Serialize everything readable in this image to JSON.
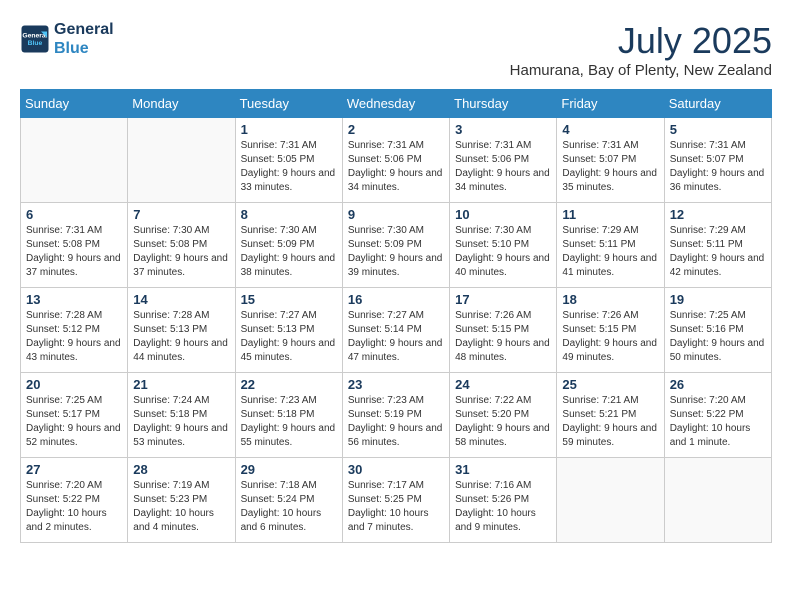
{
  "header": {
    "logo_line1": "General",
    "logo_line2": "Blue",
    "month_title": "July 2025",
    "subtitle": "Hamurana, Bay of Plenty, New Zealand"
  },
  "weekdays": [
    "Sunday",
    "Monday",
    "Tuesday",
    "Wednesday",
    "Thursday",
    "Friday",
    "Saturday"
  ],
  "weeks": [
    [
      {
        "day": "",
        "sunrise": "",
        "sunset": "",
        "daylight": ""
      },
      {
        "day": "",
        "sunrise": "",
        "sunset": "",
        "daylight": ""
      },
      {
        "day": "1",
        "sunrise": "Sunrise: 7:31 AM",
        "sunset": "Sunset: 5:05 PM",
        "daylight": "Daylight: 9 hours and 33 minutes."
      },
      {
        "day": "2",
        "sunrise": "Sunrise: 7:31 AM",
        "sunset": "Sunset: 5:06 PM",
        "daylight": "Daylight: 9 hours and 34 minutes."
      },
      {
        "day": "3",
        "sunrise": "Sunrise: 7:31 AM",
        "sunset": "Sunset: 5:06 PM",
        "daylight": "Daylight: 9 hours and 34 minutes."
      },
      {
        "day": "4",
        "sunrise": "Sunrise: 7:31 AM",
        "sunset": "Sunset: 5:07 PM",
        "daylight": "Daylight: 9 hours and 35 minutes."
      },
      {
        "day": "5",
        "sunrise": "Sunrise: 7:31 AM",
        "sunset": "Sunset: 5:07 PM",
        "daylight": "Daylight: 9 hours and 36 minutes."
      }
    ],
    [
      {
        "day": "6",
        "sunrise": "Sunrise: 7:31 AM",
        "sunset": "Sunset: 5:08 PM",
        "daylight": "Daylight: 9 hours and 37 minutes."
      },
      {
        "day": "7",
        "sunrise": "Sunrise: 7:30 AM",
        "sunset": "Sunset: 5:08 PM",
        "daylight": "Daylight: 9 hours and 37 minutes."
      },
      {
        "day": "8",
        "sunrise": "Sunrise: 7:30 AM",
        "sunset": "Sunset: 5:09 PM",
        "daylight": "Daylight: 9 hours and 38 minutes."
      },
      {
        "day": "9",
        "sunrise": "Sunrise: 7:30 AM",
        "sunset": "Sunset: 5:09 PM",
        "daylight": "Daylight: 9 hours and 39 minutes."
      },
      {
        "day": "10",
        "sunrise": "Sunrise: 7:30 AM",
        "sunset": "Sunset: 5:10 PM",
        "daylight": "Daylight: 9 hours and 40 minutes."
      },
      {
        "day": "11",
        "sunrise": "Sunrise: 7:29 AM",
        "sunset": "Sunset: 5:11 PM",
        "daylight": "Daylight: 9 hours and 41 minutes."
      },
      {
        "day": "12",
        "sunrise": "Sunrise: 7:29 AM",
        "sunset": "Sunset: 5:11 PM",
        "daylight": "Daylight: 9 hours and 42 minutes."
      }
    ],
    [
      {
        "day": "13",
        "sunrise": "Sunrise: 7:28 AM",
        "sunset": "Sunset: 5:12 PM",
        "daylight": "Daylight: 9 hours and 43 minutes."
      },
      {
        "day": "14",
        "sunrise": "Sunrise: 7:28 AM",
        "sunset": "Sunset: 5:13 PM",
        "daylight": "Daylight: 9 hours and 44 minutes."
      },
      {
        "day": "15",
        "sunrise": "Sunrise: 7:27 AM",
        "sunset": "Sunset: 5:13 PM",
        "daylight": "Daylight: 9 hours and 45 minutes."
      },
      {
        "day": "16",
        "sunrise": "Sunrise: 7:27 AM",
        "sunset": "Sunset: 5:14 PM",
        "daylight": "Daylight: 9 hours and 47 minutes."
      },
      {
        "day": "17",
        "sunrise": "Sunrise: 7:26 AM",
        "sunset": "Sunset: 5:15 PM",
        "daylight": "Daylight: 9 hours and 48 minutes."
      },
      {
        "day": "18",
        "sunrise": "Sunrise: 7:26 AM",
        "sunset": "Sunset: 5:15 PM",
        "daylight": "Daylight: 9 hours and 49 minutes."
      },
      {
        "day": "19",
        "sunrise": "Sunrise: 7:25 AM",
        "sunset": "Sunset: 5:16 PM",
        "daylight": "Daylight: 9 hours and 50 minutes."
      }
    ],
    [
      {
        "day": "20",
        "sunrise": "Sunrise: 7:25 AM",
        "sunset": "Sunset: 5:17 PM",
        "daylight": "Daylight: 9 hours and 52 minutes."
      },
      {
        "day": "21",
        "sunrise": "Sunrise: 7:24 AM",
        "sunset": "Sunset: 5:18 PM",
        "daylight": "Daylight: 9 hours and 53 minutes."
      },
      {
        "day": "22",
        "sunrise": "Sunrise: 7:23 AM",
        "sunset": "Sunset: 5:18 PM",
        "daylight": "Daylight: 9 hours and 55 minutes."
      },
      {
        "day": "23",
        "sunrise": "Sunrise: 7:23 AM",
        "sunset": "Sunset: 5:19 PM",
        "daylight": "Daylight: 9 hours and 56 minutes."
      },
      {
        "day": "24",
        "sunrise": "Sunrise: 7:22 AM",
        "sunset": "Sunset: 5:20 PM",
        "daylight": "Daylight: 9 hours and 58 minutes."
      },
      {
        "day": "25",
        "sunrise": "Sunrise: 7:21 AM",
        "sunset": "Sunset: 5:21 PM",
        "daylight": "Daylight: 9 hours and 59 minutes."
      },
      {
        "day": "26",
        "sunrise": "Sunrise: 7:20 AM",
        "sunset": "Sunset: 5:22 PM",
        "daylight": "Daylight: 10 hours and 1 minute."
      }
    ],
    [
      {
        "day": "27",
        "sunrise": "Sunrise: 7:20 AM",
        "sunset": "Sunset: 5:22 PM",
        "daylight": "Daylight: 10 hours and 2 minutes."
      },
      {
        "day": "28",
        "sunrise": "Sunrise: 7:19 AM",
        "sunset": "Sunset: 5:23 PM",
        "daylight": "Daylight: 10 hours and 4 minutes."
      },
      {
        "day": "29",
        "sunrise": "Sunrise: 7:18 AM",
        "sunset": "Sunset: 5:24 PM",
        "daylight": "Daylight: 10 hours and 6 minutes."
      },
      {
        "day": "30",
        "sunrise": "Sunrise: 7:17 AM",
        "sunset": "Sunset: 5:25 PM",
        "daylight": "Daylight: 10 hours and 7 minutes."
      },
      {
        "day": "31",
        "sunrise": "Sunrise: 7:16 AM",
        "sunset": "Sunset: 5:26 PM",
        "daylight": "Daylight: 10 hours and 9 minutes."
      },
      {
        "day": "",
        "sunrise": "",
        "sunset": "",
        "daylight": ""
      },
      {
        "day": "",
        "sunrise": "",
        "sunset": "",
        "daylight": ""
      }
    ]
  ]
}
